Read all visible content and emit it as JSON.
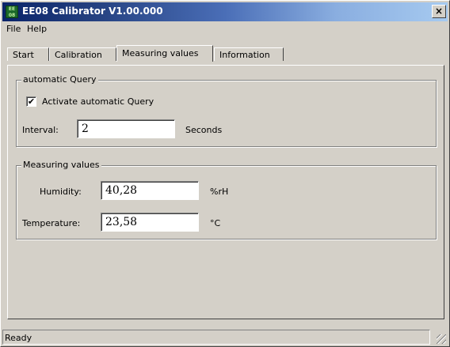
{
  "window": {
    "title": "EE08 Calibrator V1.00.000",
    "close_label": "×"
  },
  "menu": {
    "file": "File",
    "help": "Help"
  },
  "tabs": [
    {
      "label": "Start"
    },
    {
      "label": "Calibration"
    },
    {
      "label": "Measuring values",
      "active": true
    },
    {
      "label": "Information"
    }
  ],
  "auto_query": {
    "group_title": "automatic Query",
    "checkbox_label": "Activate automatic Query",
    "checked": true,
    "interval_label": "Interval:",
    "interval_value": "2",
    "interval_unit": "Seconds"
  },
  "measuring": {
    "group_title": "Measuring values",
    "humidity_label": "Humidity:",
    "humidity_value": "40,28",
    "humidity_unit": "%rH",
    "temperature_label": "Temperature:",
    "temperature_value": "23,58",
    "temperature_unit": "°C"
  },
  "status": {
    "text": "Ready"
  },
  "icons": {
    "app": "app-icon",
    "close": "close-icon",
    "grip": "resize-grip-icon"
  }
}
